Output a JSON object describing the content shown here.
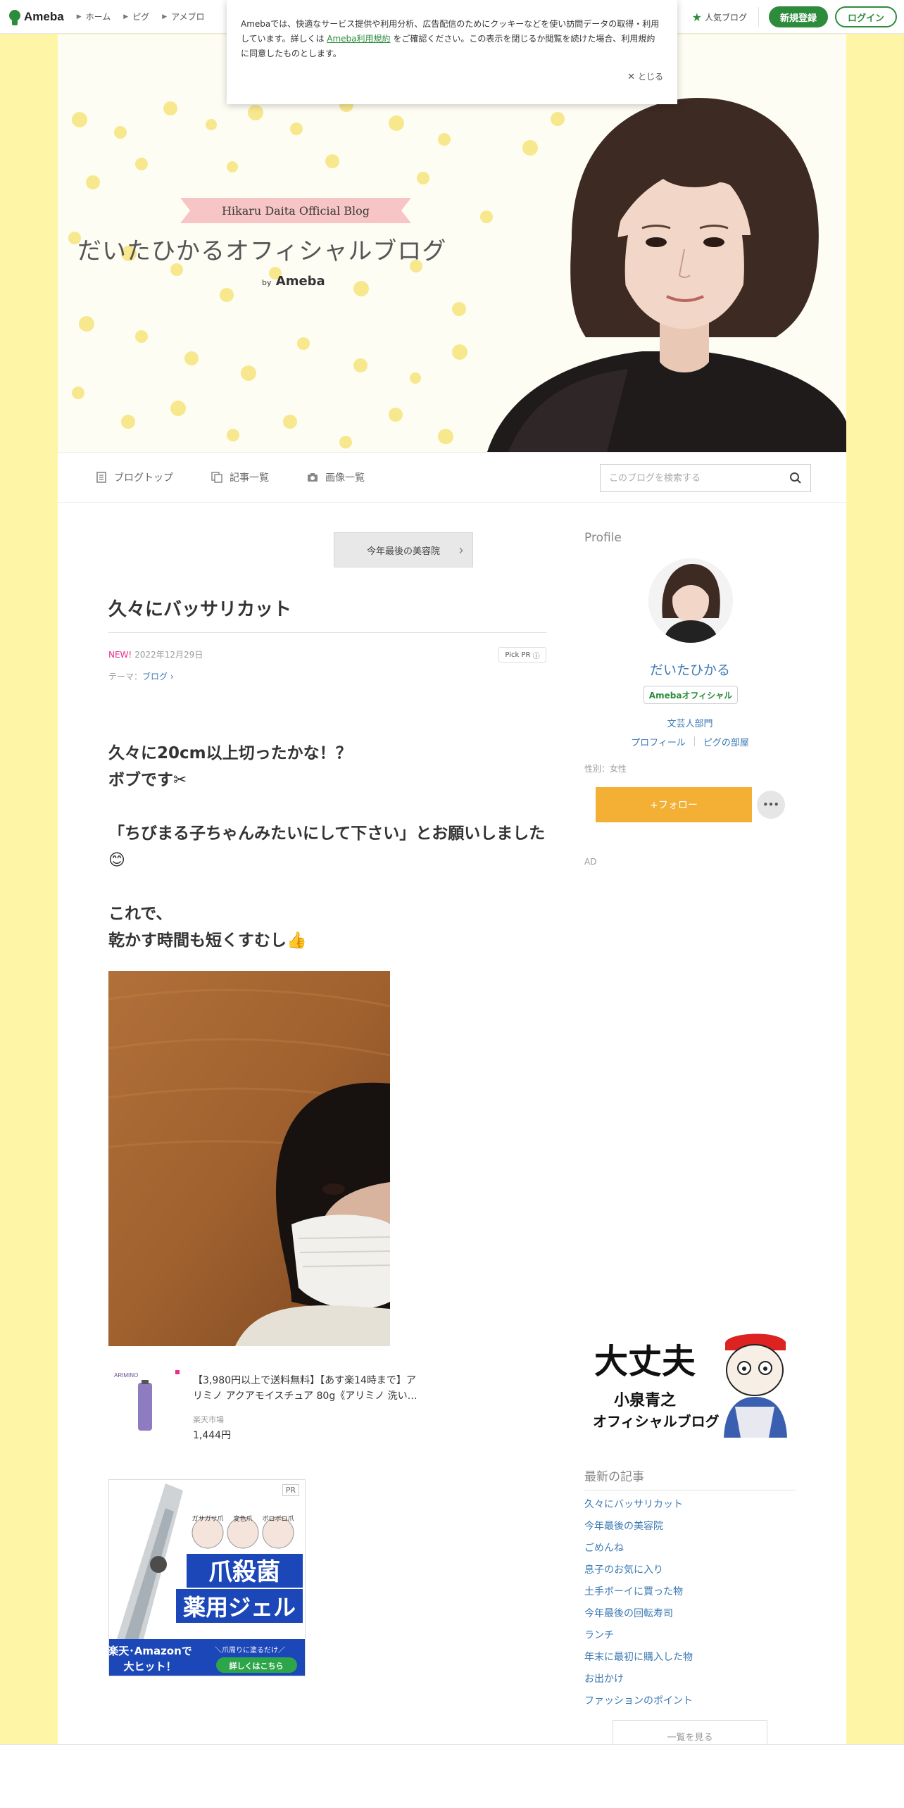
{
  "topbar": {
    "logo_text": "Ameba",
    "nav": [
      "ホーム",
      "ピグ",
      "アメブロ"
    ],
    "popular_label": "人気ブログ",
    "signup_label": "新規登録",
    "login_label": "ログイン"
  },
  "cookie": {
    "text_before": "Amebaでは、快適なサービス提供や利用分析、広告配信のためにクッキーなどを使い訪問データの取得・利用しています。詳しくは ",
    "link_text": "Ameba利用規約",
    "text_after": " をご確認ください。この表示を閉じるか閲覧を続けた場合、利用規約に同意したものとします。",
    "close_label": "とじる"
  },
  "banner": {
    "ribbon": "Hikaru Daita Official Blog",
    "title": "だいたひかるオフィシャルブログ",
    "by": "by",
    "brand": "Ameba",
    "dot_color": "#f6e37a"
  },
  "blog_nav": {
    "items": [
      "ブログトップ",
      "記事一覧",
      "画像一覧"
    ],
    "search_placeholder": "このブログを検索する"
  },
  "entry": {
    "prev_label": "今年最後の美容院",
    "title": "久々にバッサリカット",
    "new_label": "NEW!",
    "date": "2022年12月29日",
    "pick_pr": "Pick PR",
    "theme_prefix": "テーマ：",
    "theme": "ブログ",
    "body": [
      "久々に20cm以上切ったかな！？",
      "ボブです✂",
      "",
      "「ちびまる子ちゃんみたいにして下さい」とお願いしました😊",
      "",
      "これで、",
      "乾かす時間も短くすむし👍"
    ]
  },
  "product": {
    "title": "【3,980円以上で送料無料】【あす楽14時まで】アリミノ アクアモイスチュア 80g《アリミノ 洗い…",
    "shop": "楽天市場",
    "price": "1,444円",
    "thumb_brand": "ARIMINO"
  },
  "ad": {
    "pr_label": "PR",
    "tags": [
      "ガサガサ爪",
      "変色爪",
      "ボロボロ爪"
    ],
    "headline_1": "爪殺菌",
    "headline_2": "薬用ジェル",
    "footer_1": "楽天･Amazonで",
    "footer_2": "大ヒット！",
    "footer_note": "＼爪周りに塗るだけ／",
    "cta": "詳しくはこちら"
  },
  "sidebar": {
    "profile_heading": "Profile",
    "name": "だいたひかる",
    "badge": "Amebaオフィシャル",
    "category": "文芸人部門",
    "links": [
      "プロフィール",
      "ピグの部屋"
    ],
    "gender": "性別：女性",
    "follow_label": "+フォロー",
    "more_label": "•••",
    "ad_label": "AD",
    "banner_big": "大丈夫",
    "banner_sub": "小泉青之",
    "banner_sub2": "オフィシャルブログ",
    "recent_heading": "最新の記事",
    "recent": [
      "久々にバッサリカット",
      "今年最後の美容院",
      "ごめんね",
      "息子のお気に入り",
      "土手ボーイに買った物",
      "今年最後の回転寿司",
      "ランチ",
      "年末に最初に購入した物",
      "お出かけ",
      "ファッションのポイント"
    ],
    "recent_more": "一覧を見る"
  },
  "colors": {
    "background": "#fff5a6",
    "brand_green": "#2d8c3c",
    "link_blue": "#3a78b3",
    "follow_orange": "#f3b034",
    "new_pink": "#e6308a"
  }
}
